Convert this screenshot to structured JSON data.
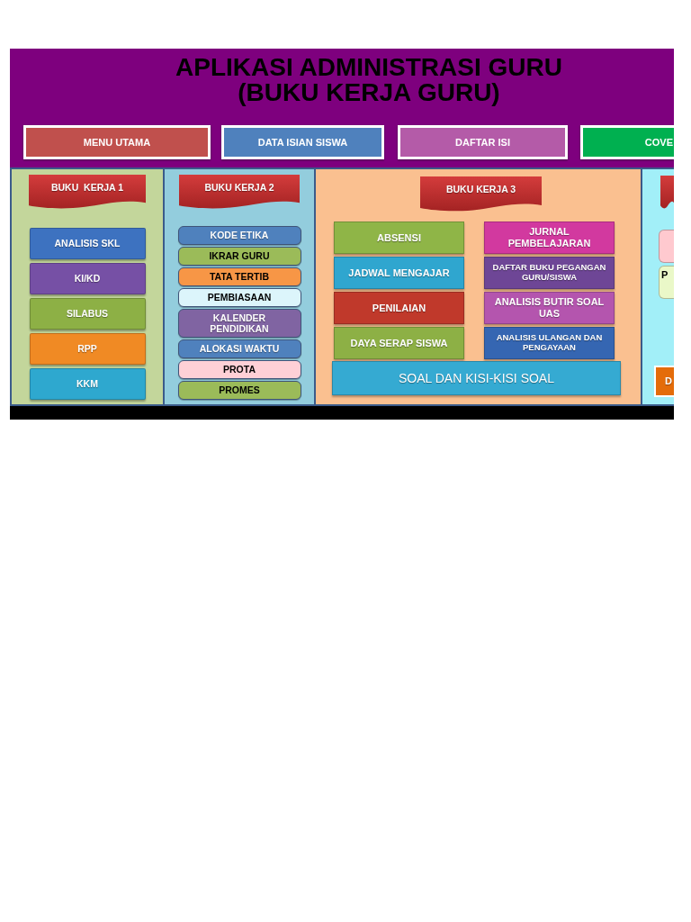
{
  "header": {
    "title": "APLIKASI ADMINISTRASI GURU\n(BUKU KERJA GURU)"
  },
  "nav_buttons": [
    {
      "label": "MENU UTAMA",
      "color": "#c0504d"
    },
    {
      "label": "DATA ISIAN SISWA",
      "color": "#4f81bd"
    },
    {
      "label": "DAFTAR ISI",
      "color": "#b45ba8"
    },
    {
      "label": "COVE",
      "color": "#00b050"
    }
  ],
  "columns": [
    {
      "kind": "list",
      "color": "#c3d69b",
      "banner": "BUKU  KERJA 1",
      "items": [
        {
          "label": "ANALISIS SKL",
          "color": "#3d72c0"
        },
        {
          "label": "KI/KD",
          "color": "#7650a5"
        },
        {
          "label": "SILABUS",
          "color": "#8db045"
        },
        {
          "label": "RPP",
          "color": "#f08a24"
        },
        {
          "label": "KKM",
          "color": "#2ea8cf"
        }
      ]
    },
    {
      "kind": "rounded_list",
      "color": "#93cddd",
      "banner": "BUKU KERJA 2",
      "items": [
        {
          "label": "KODE ETIKA",
          "color": "#4f81bd"
        },
        {
          "label": "IKRAR GURU",
          "color": "#9bbb59"
        },
        {
          "label": "TATA TERTIB",
          "color": "#f79646"
        },
        {
          "label": "PEMBIASAAN",
          "color": "#dcf5fb"
        },
        {
          "label": "KALENDER\nPENDIDIKAN",
          "color": "#8064a2"
        },
        {
          "label": "ALOKASI WAKTU",
          "color": "#4f81bd"
        },
        {
          "label": "PROTA",
          "color": "#ffd0d6"
        },
        {
          "label": "PROMES",
          "color": "#9bbb59"
        }
      ]
    },
    {
      "kind": "split",
      "color": "#fac090",
      "banner": "BUKU KERJA 3",
      "left_items": [
        {
          "label": "ABSENSI",
          "color": "#8fb547"
        },
        {
          "label": "JADWAL MENGAJAR",
          "color": "#2fa6cf"
        },
        {
          "label": "PENILAIAN",
          "color": "#c0392b"
        },
        {
          "label": "DAYA SERAP SISWA",
          "color": "#8db045"
        }
      ],
      "right_items": [
        {
          "label": "JURNAL\nPEMBELAJARAN",
          "color": "#d2399f"
        },
        {
          "label": "DAFTAR BUKU PEGANGAN\nGURU/SISWA",
          "color": "#6e4696"
        },
        {
          "label": "ANALISIS BUTIR SOAL\nUAS",
          "color": "#b455ae"
        },
        {
          "label": "ANALISIS ULANGAN DAN\nPENGAYAAN",
          "color": "#3566b2"
        }
      ],
      "footer_item": {
        "label": "SOAL DAN KISI-KISI SOAL",
        "color": "#35aad2"
      }
    },
    {
      "kind": "edge",
      "color": "#a2eff8",
      "items": [
        {
          "kind": "rounded",
          "color": "#ffc9cf"
        },
        {
          "kind": "rounded",
          "label": "P",
          "color": "#eaf8c8"
        },
        {
          "kind": "framed",
          "label": "D",
          "color": "#e46c0a"
        }
      ]
    }
  ]
}
